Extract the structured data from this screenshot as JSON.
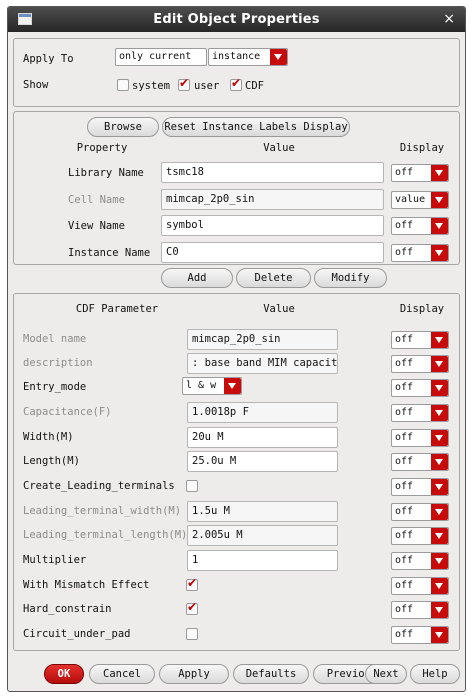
{
  "window": {
    "title": "Edit Object Properties",
    "close_label": "×"
  },
  "top": {
    "apply_to_label": "Apply To",
    "apply_to_scope": "only current",
    "apply_to_object": "instance",
    "show_label": "Show",
    "show_options": [
      {
        "label": "system",
        "checked": false
      },
      {
        "label": "user",
        "checked": true
      },
      {
        "label": "CDF",
        "checked": true
      }
    ]
  },
  "instance_panel": {
    "browse_label": "Browse",
    "reset_label": "Reset Instance Labels Display",
    "headers": {
      "property": "Property",
      "value": "Value",
      "display": "Display"
    },
    "rows": [
      {
        "label": "Library Name",
        "value": "tsmc18",
        "display": "off",
        "dim": false
      },
      {
        "label": "Cell Name",
        "value": "mimcap_2p0_sin",
        "display": "value",
        "dim": true
      },
      {
        "label": "View Name",
        "value": "symbol",
        "display": "off",
        "dim": false
      },
      {
        "label": "Instance Name",
        "value": "C0",
        "display": "off",
        "dim": false
      }
    ]
  },
  "actions": {
    "add_label": "Add",
    "delete_label": "Delete",
    "modify_label": "Modify"
  },
  "cdf_panel": {
    "headers": {
      "parameter": "CDF Parameter",
      "value": "Value",
      "display": "Display"
    },
    "rows": [
      {
        "label": "Model name",
        "kind": "text",
        "value": "mimcap_2p0_sin",
        "display": "off",
        "dim": true
      },
      {
        "label": "description",
        "kind": "text",
        "value": ": base band MIM capacitor",
        "display": "off",
        "dim": true
      },
      {
        "label": "Entry_mode",
        "kind": "select",
        "value": "l & w",
        "display": "off",
        "dim": false
      },
      {
        "label": "Capacitance(F)",
        "kind": "text",
        "value": "1.0018p F",
        "display": "off",
        "dim": true
      },
      {
        "label": "Width(M)",
        "kind": "text",
        "value": "20u M",
        "display": "off",
        "dim": false
      },
      {
        "label": "Length(M)",
        "kind": "text",
        "value": "25.0u M",
        "display": "off",
        "dim": false
      },
      {
        "label": "Create_Leading_terminals",
        "kind": "check",
        "checked": false,
        "display": "off",
        "dim": false
      },
      {
        "label": "Leading_terminal_width(M)",
        "kind": "text",
        "value": "1.5u M",
        "display": "off",
        "dim": true
      },
      {
        "label": "Leading_terminal_length(M)",
        "kind": "text",
        "value": "2.005u M",
        "display": "off",
        "dim": true
      },
      {
        "label": "Multiplier",
        "kind": "text",
        "value": "1",
        "display": "off",
        "dim": false
      },
      {
        "label": "With Mismatch Effect",
        "kind": "check",
        "checked": true,
        "display": "off",
        "dim": false
      },
      {
        "label": "Hard_constrain",
        "kind": "check",
        "checked": true,
        "display": "off",
        "dim": false
      },
      {
        "label": "Circuit_under_pad",
        "kind": "check",
        "checked": false,
        "display": "off",
        "dim": false
      }
    ]
  },
  "footer": {
    "buttons": [
      {
        "name": "ok-button",
        "label": "OK"
      },
      {
        "name": "cancel-button",
        "label": "Cancel"
      },
      {
        "name": "apply-button",
        "label": "Apply"
      },
      {
        "name": "defaults-button",
        "label": "Defaults"
      },
      {
        "name": "previous-button",
        "label": "Previous"
      },
      {
        "name": "next-button",
        "label": "Next"
      },
      {
        "name": "help-button",
        "label": "Help"
      }
    ]
  },
  "colors": {
    "accent": "#c70a0a",
    "titlebar": "#333333",
    "panel": "#edeceb"
  }
}
